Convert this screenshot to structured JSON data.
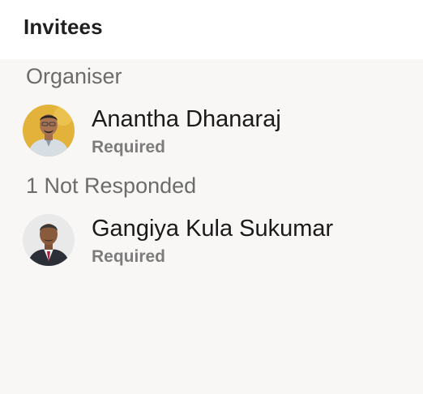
{
  "header": {
    "title": "Invitees"
  },
  "sections": [
    {
      "label": "Organiser",
      "invitees": [
        {
          "name": "Anantha Dhanaraj",
          "status": "Required",
          "avatar": "photo-avatar"
        }
      ]
    },
    {
      "label": "1 Not Responded",
      "invitees": [
        {
          "name": "Gangiya Kula Sukumar",
          "status": "Required",
          "avatar": "photo-avatar"
        }
      ]
    }
  ],
  "colors": {
    "panel_background": "#f8f7f6",
    "section_label": "#6b6b6b",
    "name_text": "#1a1a1a",
    "status_text": "#7c7c7c"
  }
}
